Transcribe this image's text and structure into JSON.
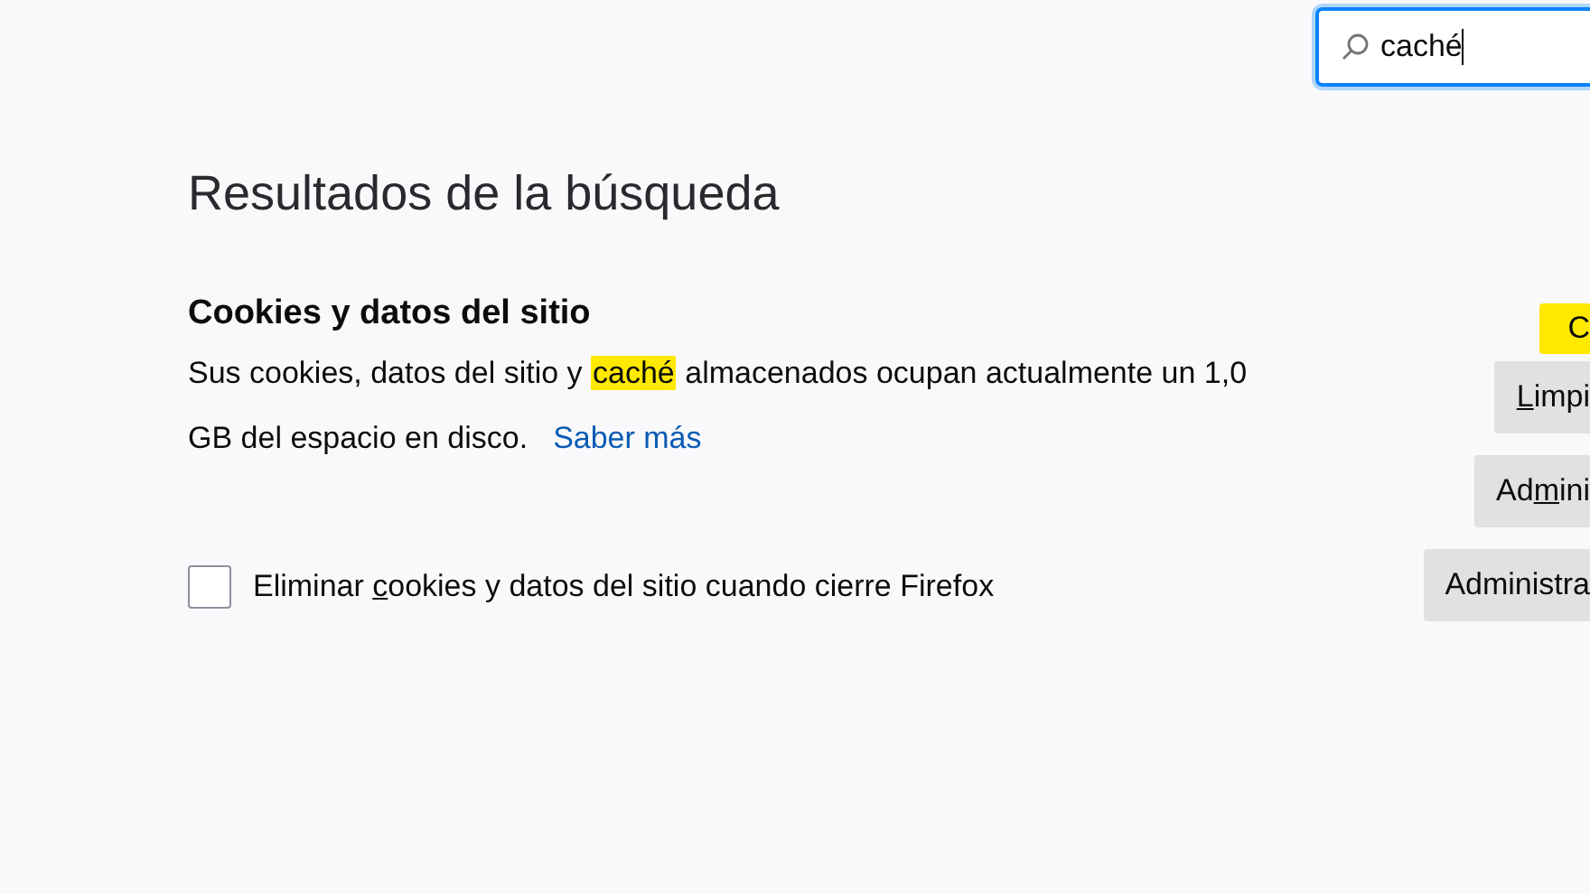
{
  "search": {
    "value": "caché",
    "focused": true
  },
  "heading": "Resultados de la búsqueda",
  "section": {
    "title": "Cookies y datos del sitio",
    "description": "Sus cookies, datos del sitio y **caché** almacenados ocupan actualmente un 1,0 GB del espacio en disco.",
    "link": "Saber más",
    "checkbox": {
      "label": [
        {
          "text": "Eliminar ",
          "underlined": false
        },
        {
          "text": "c",
          "underlined": true
        },
        {
          "text": "ookies y datos del sitio cuando cierre Firefox",
          "underlined": false
        }
      ],
      "checked": false
    }
  },
  "buttons": [
    {
      "kind": "match",
      "label": [
        {
          "text": "C",
          "underlined": false
        }
      ]
    },
    {
      "kind": "button",
      "label": [
        {
          "text": "L",
          "underlined": true
        },
        {
          "text": "impi",
          "underlined": false
        }
      ]
    },
    {
      "kind": "button",
      "label": [
        {
          "text": "Ad",
          "underlined": false
        },
        {
          "text": "m",
          "underlined": true
        },
        {
          "text": "ini",
          "underlined": false
        }
      ]
    },
    {
      "kind": "button",
      "label": [
        {
          "text": "Administra",
          "underlined": false
        }
      ]
    }
  ]
}
